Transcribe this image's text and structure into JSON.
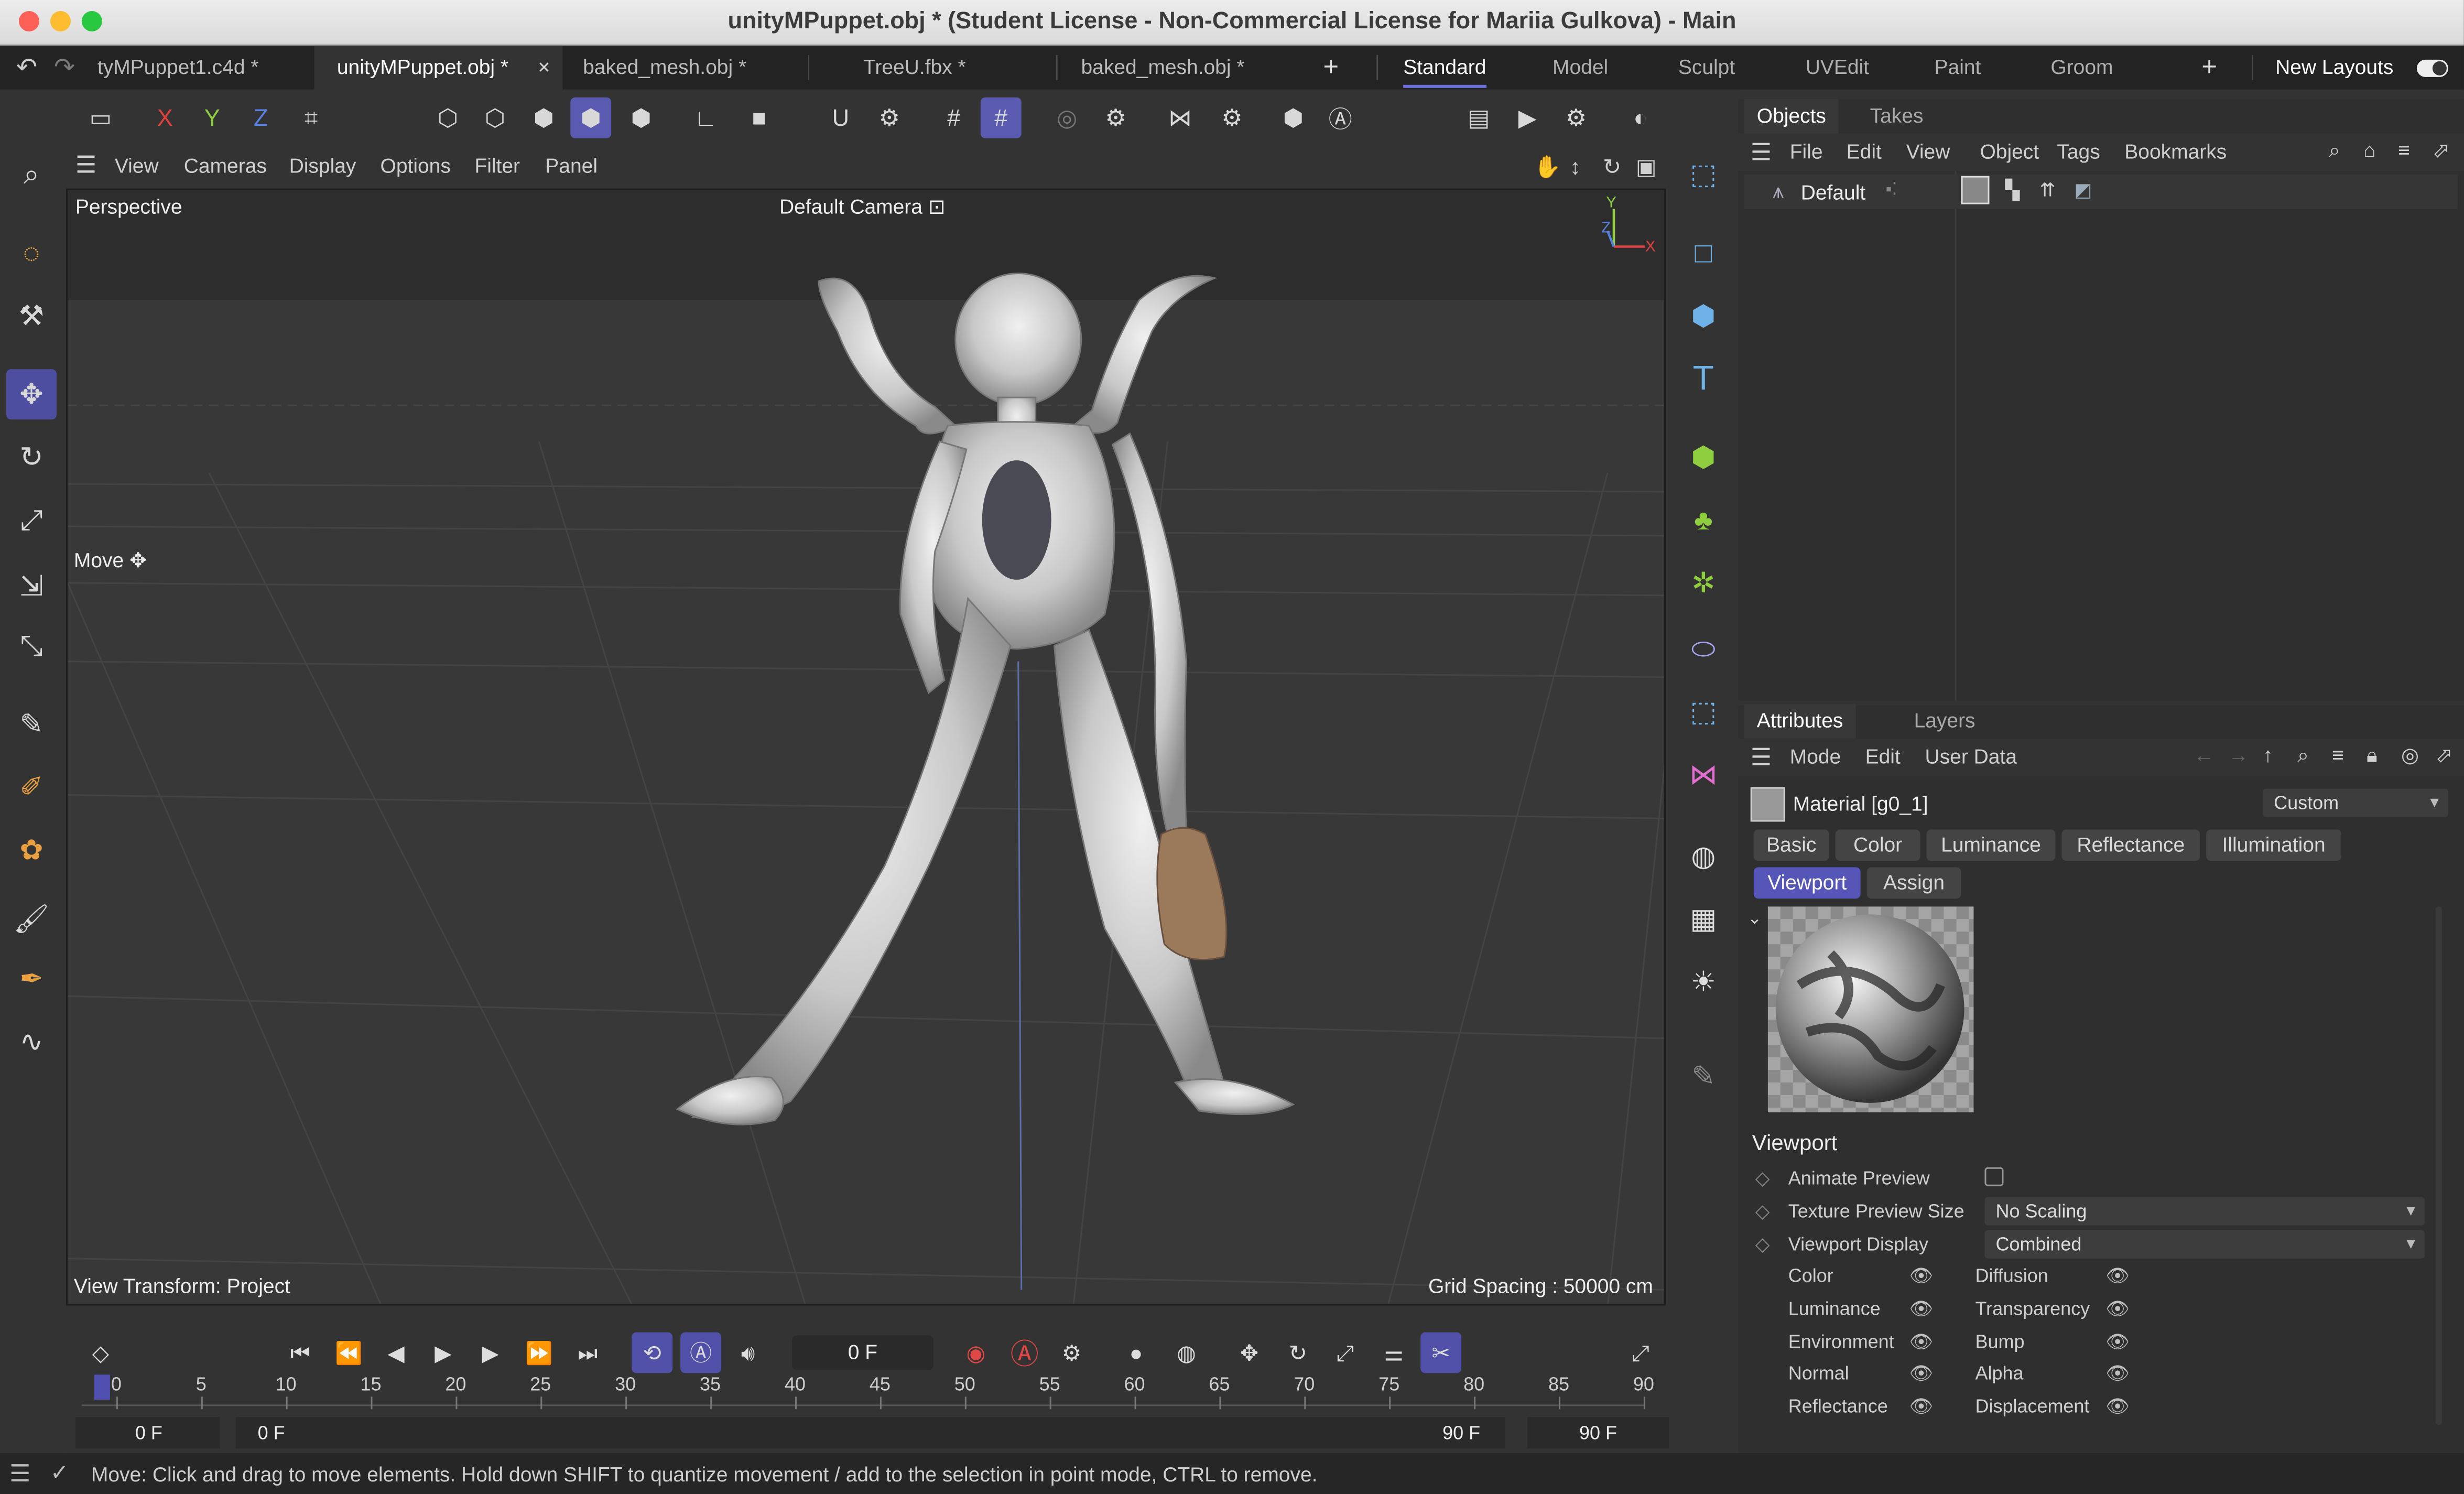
{
  "window": {
    "title": "unityMPuppet.obj * (Student License - Non-Commercial License for Mariia Gulkova) - Main"
  },
  "tabs": [
    "tyMPuppet1.c4d *",
    "unityMPuppet.obj *",
    "baked_mesh.obj *",
    "TreeU.fbx *",
    "baked_mesh.obj *"
  ],
  "tab_close": "×",
  "tab_add": "+",
  "layouts": [
    "Standard",
    "Model",
    "Sculpt",
    "UVEdit",
    "Paint",
    "Groom"
  ],
  "layout_add": "+",
  "new_layouts": "New Layouts",
  "axes": [
    "X",
    "Y",
    "Z"
  ],
  "viewport": {
    "menu": [
      "View",
      "Cameras",
      "Display",
      "Options",
      "Filter",
      "Panel"
    ],
    "name": "Perspective",
    "camera": "Default Camera",
    "hud_move": "Move",
    "view_transform": "View Transform: Project",
    "grid_spacing": "Grid Spacing : 50000 cm",
    "axis_y": "Y",
    "axis_z": "Z",
    "axis_x": "X"
  },
  "objects_panel": {
    "tabs": [
      "Objects",
      "Takes"
    ],
    "menu": [
      "File",
      "Edit",
      "View",
      "Object",
      "Tags",
      "Bookmarks"
    ],
    "object_name": "Default"
  },
  "attributes_panel": {
    "tabs": [
      "Attributes",
      "Layers"
    ],
    "menu": [
      "Mode",
      "Edit",
      "User Data"
    ],
    "material_name": "Material [g0_1]",
    "mode_dropdown": "Custom",
    "tabs_row1": [
      "Basic",
      "Color",
      "Luminance",
      "Reflectance",
      "Illumination"
    ],
    "tabs_row2": [
      "Viewport",
      "Assign"
    ],
    "section": "Viewport",
    "animate_preview": "Animate Preview",
    "texture_preview_label": "Texture Preview Size",
    "texture_preview_value": "No Scaling",
    "viewport_display_label": "Viewport Display",
    "viewport_display_value": "Combined",
    "channels_left": [
      "Color",
      "Luminance",
      "Environment",
      "Normal",
      "Reflectance"
    ],
    "channels_right": [
      "Diffusion",
      "Transparency",
      "Bump",
      "Alpha",
      "Displacement"
    ]
  },
  "timeline": {
    "current_frame": "0 F",
    "ticks": [
      "0",
      "5",
      "10",
      "15",
      "20",
      "25",
      "30",
      "35",
      "40",
      "45",
      "50",
      "55",
      "60",
      "65",
      "70",
      "75",
      "80",
      "85",
      "90"
    ],
    "start": "0 F",
    "range_start": "0 F",
    "range_end": "90 F",
    "end": "90 F"
  },
  "status": {
    "message": "Move: Click and drag to move elements. Hold down SHIFT to quantize movement / add to the selection in point mode, CTRL to remove."
  },
  "colors": {
    "accent": "#5a5ab8",
    "axis_x": "#e04040",
    "axis_y": "#8fcf3f",
    "axis_z": "#5a80e0",
    "record": "#e04848"
  }
}
